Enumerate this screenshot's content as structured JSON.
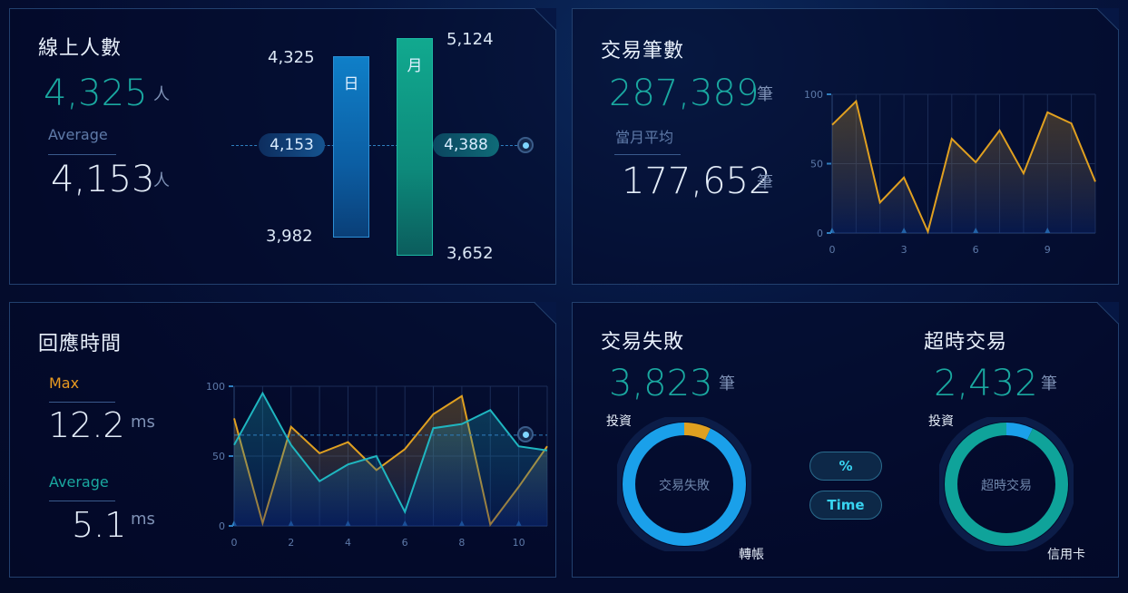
{
  "online": {
    "title": "線上人數",
    "value": "4,325",
    "unit": "人",
    "avg_label": "Average",
    "avg_value": "4,153",
    "avg_unit": "人",
    "day_label": "日",
    "month_label": "月",
    "day_top": "4,325",
    "day_bottom": "3,982",
    "month_top": "5,124",
    "month_bottom": "3,652",
    "day_marker": "4,153",
    "month_marker": "4,388"
  },
  "trades": {
    "title": "交易筆數",
    "value": "287,389",
    "unit": "筆",
    "avg_label": "當月平均",
    "avg_value": "177,652",
    "avg_unit": "筆",
    "chart_data": {
      "type": "area",
      "x": [
        0,
        1,
        2,
        3,
        4,
        5,
        6,
        7,
        8,
        9,
        10,
        11
      ],
      "series": [
        {
          "values": [
            78,
            95,
            22,
            40,
            1,
            68,
            51,
            74,
            43,
            87,
            79,
            37
          ]
        }
      ],
      "ylim": [
        0,
        100
      ],
      "y_ticks": [
        "0",
        "50",
        "100"
      ],
      "x_ticks": [
        "0",
        "3",
        "6",
        "9"
      ],
      "color": "#e0a020"
    }
  },
  "response": {
    "title": "回應時間",
    "max_label": "Max",
    "max_value": "12.2",
    "max_unit": "ms",
    "avg_label": "Average",
    "avg_value": "5.1",
    "avg_unit": "ms",
    "chart_data": {
      "type": "line",
      "x": [
        0,
        1,
        2,
        3,
        4,
        5,
        6,
        7,
        8,
        9,
        10,
        11
      ],
      "series": [
        {
          "color": "#e0a020",
          "values": [
            77,
            2,
            71,
            52,
            60,
            40,
            55,
            80,
            93,
            1,
            28,
            57
          ]
        },
        {
          "color": "#1fb6c0",
          "values": [
            58,
            95,
            58,
            32,
            44,
            50,
            10,
            70,
            73,
            83,
            57,
            54
          ]
        }
      ],
      "ylim": [
        0,
        100
      ],
      "y_ticks": [
        "0",
        "50",
        "100"
      ],
      "x_ticks": [
        "0",
        "2",
        "4",
        "6",
        "8",
        "10"
      ]
    }
  },
  "failed": {
    "title": "交易失敗",
    "value": "3,823",
    "unit": "筆",
    "label_top": "投資",
    "label_bottom": "轉帳",
    "center": "交易失敗",
    "chart_data": {
      "type": "pie",
      "categories": [
        "投資",
        "轉帳"
      ],
      "values": [
        7,
        93
      ],
      "colors": [
        "#e0a020",
        "#1aa0ea"
      ]
    }
  },
  "timeout": {
    "title": "超時交易",
    "value": "2,432",
    "unit": "筆",
    "label_top": "投資",
    "label_bottom": "信用卡",
    "center": "超時交易",
    "chart_data": {
      "type": "pie",
      "categories": [
        "投資",
        "信用卡"
      ],
      "values": [
        7,
        93
      ],
      "colors": [
        "#1aa0ea",
        "#0fa39a"
      ]
    }
  },
  "toggles": {
    "percent": "%",
    "time": "Time"
  }
}
